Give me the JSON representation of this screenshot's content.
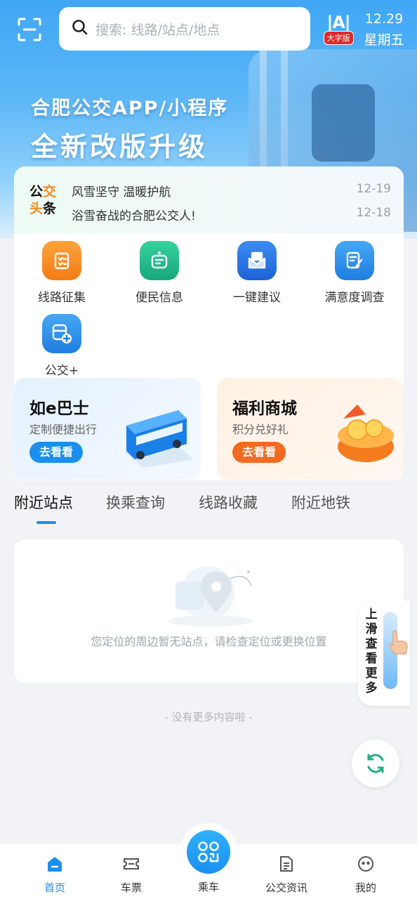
{
  "header": {
    "search_placeholder": "搜索: 线路/站点/地点",
    "bigfont_letter": "A",
    "bigfont_tag": "大字版",
    "date": "12.29",
    "weekday": "星期五"
  },
  "banner": {
    "line1": "合肥公交APP/小程序",
    "line2": "全新改版升级"
  },
  "news": {
    "logo_line1": [
      "公",
      "交"
    ],
    "logo_line2": [
      "头",
      "条"
    ],
    "items": [
      {
        "title": "风雪坚守 温暖护航",
        "date": "12-19"
      },
      {
        "title": "浴雪奋战的合肥公交人!",
        "date": "12-18"
      }
    ]
  },
  "services": [
    {
      "label": "线路征集",
      "icon": "clipboard-icon",
      "color": "#f58a1f"
    },
    {
      "label": "便民信息",
      "icon": "message-icon",
      "color": "#1fb98a"
    },
    {
      "label": "一键建议",
      "icon": "mail-icon",
      "color": "#2a7ae8"
    },
    {
      "label": "满意度调查",
      "icon": "survey-icon",
      "color": "#2a90ec"
    },
    {
      "label": "公交+",
      "icon": "bus-plus-icon",
      "color": "#2a8ef0"
    }
  ],
  "promos": [
    {
      "title": "如e巴士",
      "subtitle": "定制便捷出行",
      "button": "去看看",
      "color": "#1a8ff0"
    },
    {
      "title": "福利商城",
      "subtitle": "积分兑好礼",
      "button": "去看看",
      "color": "#f26a21"
    }
  ],
  "tabs": [
    "附近站点",
    "换乘查询",
    "线路收藏",
    "附近地铁"
  ],
  "empty_message": "您定位的周边暂无站点，请检查定位或更换位置",
  "slide_hint": "上滑查看更多",
  "no_more": "- 没有更多内容啦 -",
  "nav": [
    {
      "label": "首页",
      "icon": "home-icon",
      "active": true
    },
    {
      "label": "车票",
      "icon": "ticket-icon",
      "active": false
    },
    {
      "label": "乘车",
      "icon": "qr-code-icon",
      "active": false
    },
    {
      "label": "公交资讯",
      "icon": "news-icon",
      "active": false
    },
    {
      "label": "我的",
      "icon": "profile-icon",
      "active": false
    }
  ],
  "colors": {
    "accent": "#1a8ff0",
    "orange": "#f26a21",
    "background": "#f1f3f6"
  }
}
